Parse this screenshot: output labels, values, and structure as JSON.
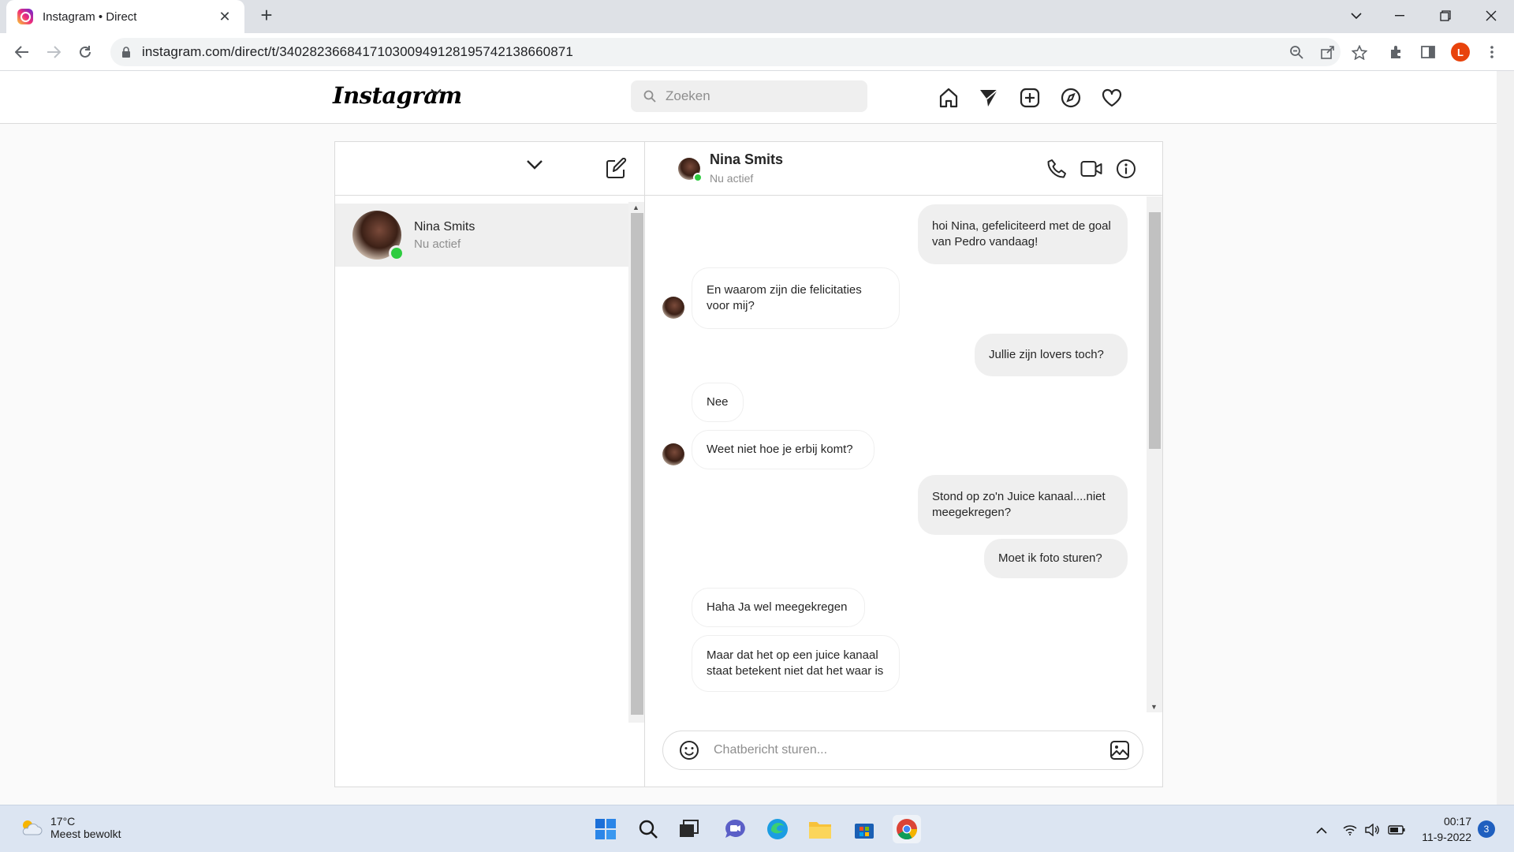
{
  "browser": {
    "tab_title": "Instagram • Direct",
    "url": "instagram.com/direct/t/340282366841710300949128195742138660871",
    "profile_initial": "L"
  },
  "instagram": {
    "logo_text": "Instagram",
    "search_placeholder": "Zoeken"
  },
  "inbox": {
    "threads": [
      {
        "name": "Nina Smits",
        "status": "Nu actief"
      }
    ]
  },
  "chat": {
    "contact_name": "Nina Smits",
    "contact_status": "Nu actief",
    "messages": [
      {
        "direction": "out",
        "text": "hoi Nina, gefeliciteerd met de goal van Pedro vandaag!"
      },
      {
        "direction": "in",
        "text": "En waarom zijn die felicitaties voor mij?"
      },
      {
        "direction": "out",
        "text": "Jullie zijn lovers toch?"
      },
      {
        "direction": "in",
        "text": "Nee"
      },
      {
        "direction": "in",
        "text": "Weet niet hoe je erbij komt?"
      },
      {
        "direction": "out",
        "text": "Stond op zo'n Juice kanaal....niet meegekregen?"
      },
      {
        "direction": "out",
        "text": "Moet ik foto sturen?"
      },
      {
        "direction": "in",
        "text": "Haha Ja wel meegekregen"
      },
      {
        "direction": "in",
        "text": "Maar dat het op een juice kanaal staat betekent niet dat het waar is"
      }
    ],
    "composer_placeholder": "Chatbericht sturen..."
  },
  "taskbar": {
    "weather_temp": "17°C",
    "weather_desc": "Meest bewolkt",
    "time": "00:17",
    "date": "11-9-2022",
    "notification_count": "3"
  },
  "colors": {
    "online": "#2ecc40",
    "bubble_out": "#efefef",
    "border": "#dbdbdb"
  }
}
